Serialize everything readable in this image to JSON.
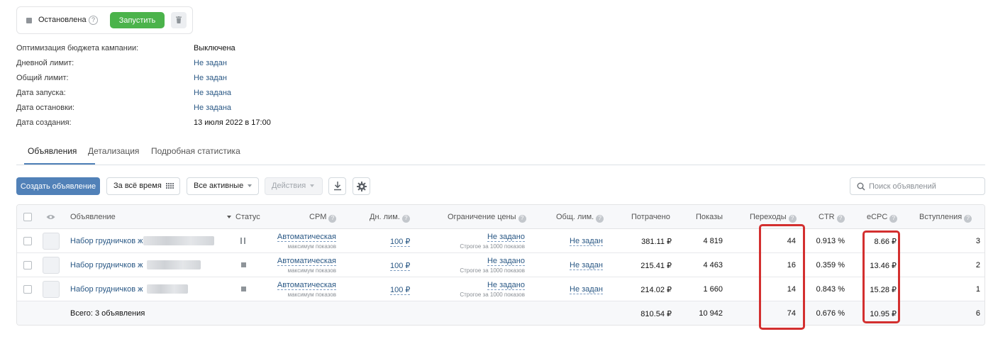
{
  "status_card": {
    "status": "Остановлена",
    "help": "?",
    "start_label": "Запустить"
  },
  "info": [
    {
      "label": "Оптимизация бюджета кампании:",
      "value": "Выключена",
      "link": false
    },
    {
      "label": "Дневной лимит:",
      "value": "Не задан",
      "link": true
    },
    {
      "label": "Общий лимит:",
      "value": "Не задан",
      "link": true
    },
    {
      "label": "Дата запуска:",
      "value": "Не задана",
      "link": true
    },
    {
      "label": "Дата остановки:",
      "value": "Не задана",
      "link": true
    },
    {
      "label": "Дата создания:",
      "value": "13 июля 2022 в 17:00",
      "link": false
    }
  ],
  "tabs": [
    "Объявления",
    "Детализация",
    "Подробная статистика"
  ],
  "toolbar": {
    "create": "Создать объявление",
    "period": "За всё время",
    "filter": "Все активные",
    "actions": "Действия",
    "search_placeholder": "Поиск объявлений"
  },
  "columns": {
    "ad": "Объявление",
    "status": "Статус",
    "cpm": "CPM",
    "day_limit": "Дн. лим.",
    "price_limit": "Ограничение цены",
    "total_limit": "Общ. лим.",
    "spent": "Потрачено",
    "impressions": "Показы",
    "clicks": "Переходы",
    "ctr": "CTR",
    "ecpc": "eCPC",
    "joins": "Вступления"
  },
  "rows": [
    {
      "name": "Набор грудничков ж 25-50",
      "status": "paused",
      "cpm": "Автоматическая",
      "cpm_sub": "максимум показов",
      "day_limit": "100 ₽",
      "price_limit": "Не задано",
      "price_sub": "Строгое за 1000 показов",
      "total_limit": "Не задан",
      "spent": "381.11 ₽",
      "impressions": "4 819",
      "clicks": "44",
      "ctr": "0.913 %",
      "ecpc": "8.66 ₽",
      "joins": "3"
    },
    {
      "name": "Набор грудничков ж",
      "status": "stopped",
      "cpm": "Автоматическая",
      "cpm_sub": "максимум показов",
      "day_limit": "100 ₽",
      "price_limit": "Не задано",
      "price_sub": "Строгое за 1000 показов",
      "total_limit": "Не задан",
      "spent": "215.41 ₽",
      "impressions": "4 463",
      "clicks": "16",
      "ctr": "0.359 %",
      "ecpc": "13.46 ₽",
      "joins": "2"
    },
    {
      "name": "Набор грудничков ж",
      "status": "stopped",
      "cpm": "Автоматическая",
      "cpm_sub": "максимум показов",
      "day_limit": "100 ₽",
      "price_limit": "Не задано",
      "price_sub": "Строгое за 1000 показов",
      "total_limit": "Не задан",
      "spent": "214.02 ₽",
      "impressions": "1 660",
      "clicks": "14",
      "ctr": "0.843 %",
      "ecpc": "15.28 ₽",
      "joins": "1"
    }
  ],
  "total": {
    "label": "Всего: 3 объявления",
    "spent": "810.54 ₽",
    "impressions": "10 942",
    "clicks": "74",
    "ctr": "0.676 %",
    "ecpc": "10.95 ₽",
    "joins": "6"
  },
  "colors": {
    "accent": "#5181b8",
    "start_green": "#4bb34b",
    "link": "#2a5885",
    "highlight": "#d32f2f"
  }
}
